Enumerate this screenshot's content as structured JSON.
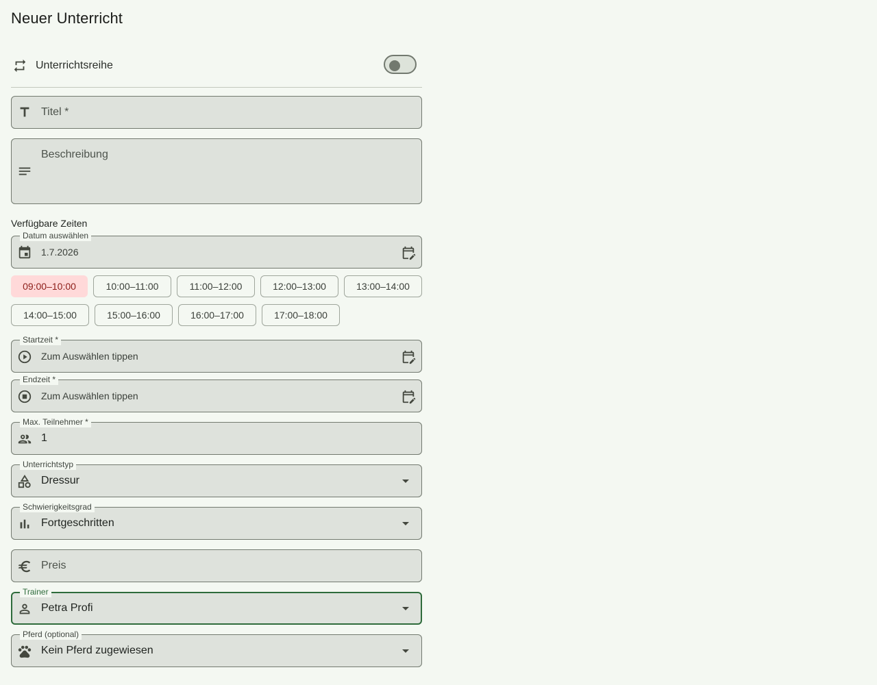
{
  "page": {
    "title": "Neuer Unterricht"
  },
  "series": {
    "label": "Unterrichtsreihe",
    "enabled": false
  },
  "title_field": {
    "placeholder": "Titel *"
  },
  "description_field": {
    "placeholder": "Beschreibung"
  },
  "available_times": {
    "label": "Verfügbare Zeiten",
    "date_legend": "Datum auswählen",
    "date_value": "1.7.2026",
    "slots": [
      "09:00–10:00",
      "10:00–11:00",
      "11:00–12:00",
      "12:00–13:00",
      "13:00–14:00",
      "14:00–15:00",
      "15:00–16:00",
      "16:00–17:00",
      "17:00–18:00"
    ],
    "selected_slot": "09:00–10:00"
  },
  "start_time": {
    "legend": "Startzeit *",
    "placeholder": "Zum Auswählen tippen"
  },
  "end_time": {
    "legend": "Endzeit *",
    "placeholder": "Zum Auswählen tippen"
  },
  "max_participants": {
    "legend": "Max. Teilnehmer *",
    "value": "1"
  },
  "lesson_type": {
    "legend": "Unterrichtstyp",
    "value": "Dressur"
  },
  "difficulty": {
    "legend": "Schwierigkeitsgrad",
    "value": "Fortgeschritten"
  },
  "price": {
    "placeholder": "Preis"
  },
  "trainer": {
    "legend": "Trainer",
    "value": "Petra Profi"
  },
  "horse": {
    "legend": "Pferd (optional)",
    "value": "Kein Pferd zugewiesen"
  },
  "icons": {
    "series": "repeat-icon",
    "title": "text-icon",
    "description": "notes-icon",
    "date": "calendar-icon",
    "calendar_edit": "calendar-edit-icon",
    "start": "play-circle-icon",
    "end": "stop-circle-icon",
    "participants": "people-icon",
    "type": "shapes-icon",
    "difficulty": "bar-chart-icon",
    "price": "euro-icon",
    "trainer": "person-icon",
    "horse": "paw-icon",
    "dropdown": "arrow-drop-down-icon"
  },
  "colors": {
    "accent": "#2e6b3b",
    "selected_slot_bg": "#ffd9d9",
    "selected_slot_text": "#8c1d18",
    "field_bg": "#dee2dc",
    "page_bg": "#f4f8f2"
  }
}
